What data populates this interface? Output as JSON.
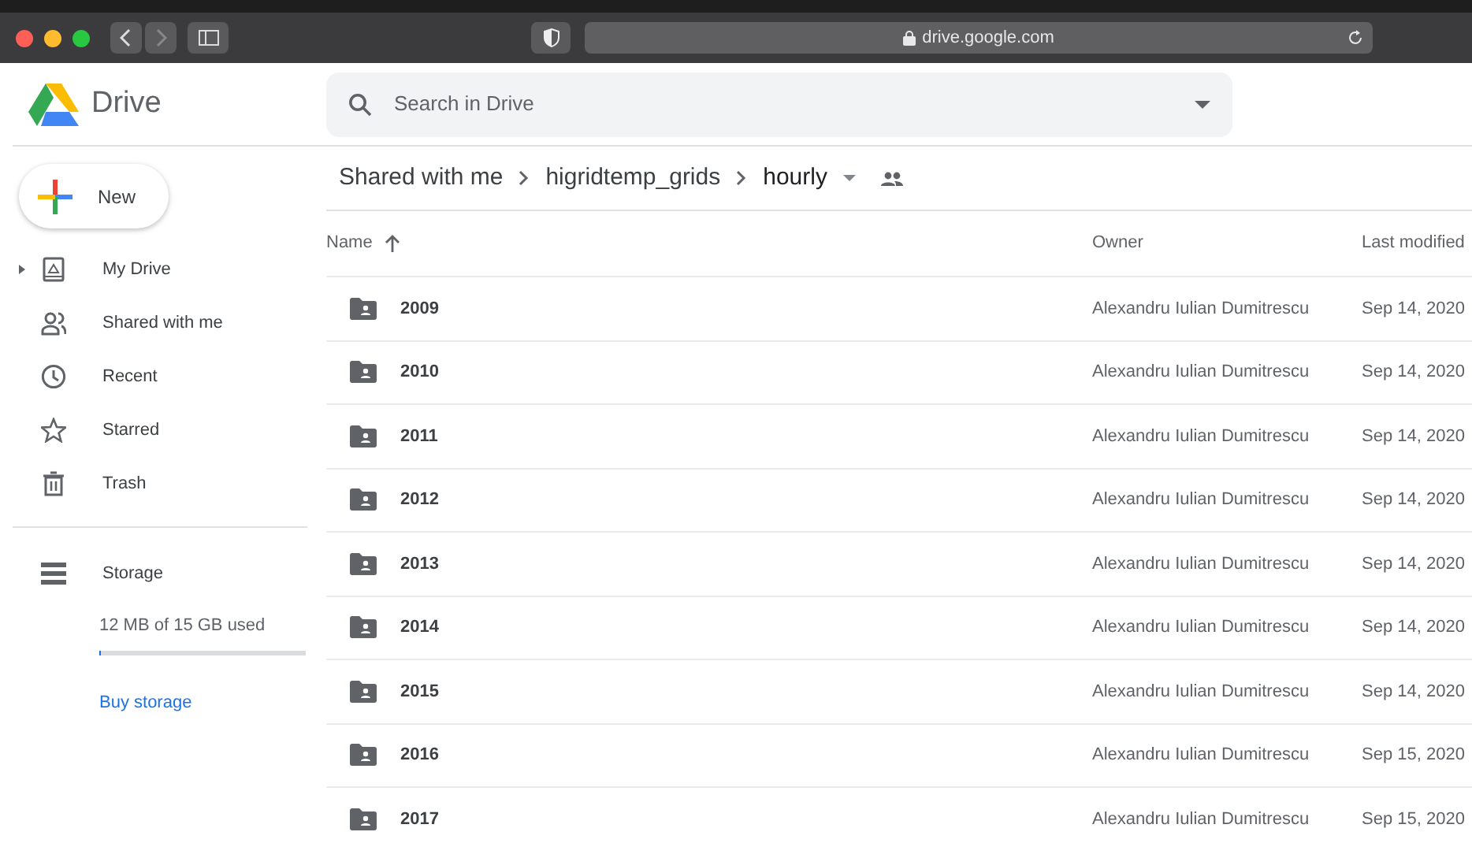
{
  "browser": {
    "url": "drive.google.com"
  },
  "app": {
    "name": "Drive"
  },
  "search": {
    "placeholder": "Search in Drive"
  },
  "new_button": {
    "label": "New"
  },
  "nav": [
    {
      "label": "My Drive",
      "kind": "drive",
      "expandable": true
    },
    {
      "label": "Shared with me",
      "kind": "shared",
      "expandable": false
    },
    {
      "label": "Recent",
      "kind": "recent",
      "expandable": false
    },
    {
      "label": "Starred",
      "kind": "starred",
      "expandable": false
    },
    {
      "label": "Trash",
      "kind": "trash",
      "expandable": false
    }
  ],
  "storage": {
    "label": "Storage",
    "usage": "12 MB of 15 GB used",
    "level": 0.001,
    "link": "Buy storage"
  },
  "breadcrumbs": [
    {
      "label": "Shared with me"
    },
    {
      "label": "higridtemp_grids"
    },
    {
      "label": "hourly"
    }
  ],
  "table": {
    "columns": [
      {
        "label": "Name",
        "sorted": true
      },
      {
        "label": "Owner",
        "sorted": false
      },
      {
        "label": "Last modified",
        "sorted": false
      }
    ],
    "rows": [
      {
        "name": "2009",
        "owner": "Alexandru Iulian Dumitrescu",
        "modified": "Sep 14, 2020"
      },
      {
        "name": "2010",
        "owner": "Alexandru Iulian Dumitrescu",
        "modified": "Sep 14, 2020"
      },
      {
        "name": "2011",
        "owner": "Alexandru Iulian Dumitrescu",
        "modified": "Sep 14, 2020"
      },
      {
        "name": "2012",
        "owner": "Alexandru Iulian Dumitrescu",
        "modified": "Sep 14, 2020"
      },
      {
        "name": "2013",
        "owner": "Alexandru Iulian Dumitrescu",
        "modified": "Sep 14, 2020"
      },
      {
        "name": "2014",
        "owner": "Alexandru Iulian Dumitrescu",
        "modified": "Sep 14, 2020"
      },
      {
        "name": "2015",
        "owner": "Alexandru Iulian Dumitrescu",
        "modified": "Sep 14, 2020"
      },
      {
        "name": "2016",
        "owner": "Alexandru Iulian Dumitrescu",
        "modified": "Sep 15, 2020"
      },
      {
        "name": "2017",
        "owner": "Alexandru Iulian Dumitrescu",
        "modified": "Sep 15, 2020"
      }
    ]
  }
}
